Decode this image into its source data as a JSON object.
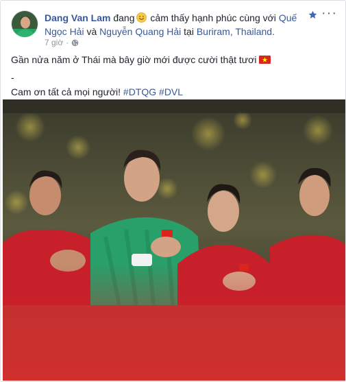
{
  "post": {
    "author": "Dang Van Lam",
    "status_pre": "đang",
    "status_feeling": "cảm thấy hạnh phúc cùng với",
    "tagged_1": "Quế Ngọc Hải",
    "conj": "và",
    "tagged_2": "Nguyễn Quang Hải",
    "at": "tại",
    "location": "Buriram, Thailand.",
    "time": "7 giờ",
    "privacy_icon": "globe-icon",
    "line1": "Gần nửa năm ở Thái mà bây giờ mới được cười thật tươi",
    "line2": "-",
    "line3_text": "Cam ơn tất cả mọi người!",
    "hashtag1": "#DTQG",
    "hashtag2": "#DVL",
    "feeling_emoji": "smiling-face-emoji",
    "flag_emoji": "vietnam-flag-emoji",
    "actions": {
      "star_icon": "star-icon",
      "more_icon": "more-dots-icon"
    },
    "colors": {
      "link": "#385898",
      "meta": "#90949c",
      "star": "#4267b2",
      "jersey_red": "#c8202a",
      "gk_green": "#29a06a"
    }
  }
}
